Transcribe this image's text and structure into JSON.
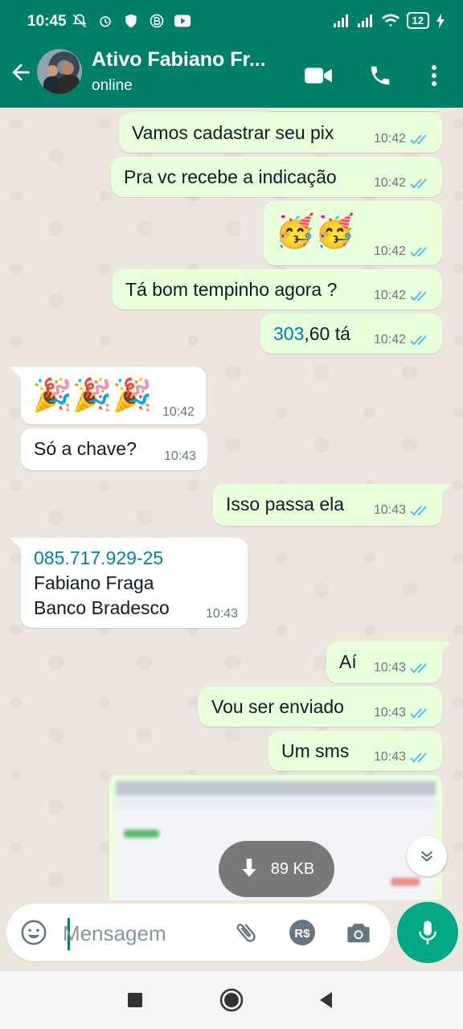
{
  "status_bar": {
    "time": "10:45",
    "battery": "12"
  },
  "header": {
    "contact_name": "Ativo Fabiano Fr...",
    "status": "online"
  },
  "messages": [
    {
      "text": "Vamos cadastrar seu pix",
      "time": "10:42"
    },
    {
      "text": "Pra vc recebe a indicação",
      "time": "10:42"
    },
    {
      "emoji": "🥳🥳",
      "time": "10:42"
    },
    {
      "text": "Tá bom tempinho agora ?",
      "time": "10:42"
    },
    {
      "link": "303",
      "text": ",60 tá",
      "time": "10:42"
    },
    {
      "emoji": "🎉🎉🎉",
      "time": "10:42"
    },
    {
      "text": "Só a chave?",
      "time": "10:43"
    },
    {
      "text": "Isso passa ela",
      "time": "10:43"
    },
    {
      "link": "085.717.929-25",
      "line2": "Fabiano Fraga",
      "line3": "Banco Bradesco",
      "time": "10:43"
    },
    {
      "text": "Aí",
      "time": "10:43"
    },
    {
      "text": "Vou ser enviado",
      "time": "10:43"
    },
    {
      "text": "Um sms",
      "time": "10:43"
    }
  ],
  "image_message": {
    "download_size": "89 KB"
  },
  "composer": {
    "placeholder": "Mensagem"
  },
  "colors": {
    "header": "#008069",
    "outgoing_bubble": "#e7ffdb",
    "incoming_bubble": "#ffffff",
    "ticks": "#53bdeb",
    "mic_button": "#00a884",
    "link": "#027eb5"
  },
  "icons": [
    "back-arrow-icon",
    "video-call-icon",
    "voice-call-icon",
    "more-options-icon",
    "read-ticks-icon",
    "emoji-icon",
    "attach-icon",
    "payment-icon",
    "camera-icon",
    "mic-icon",
    "download-icon",
    "scroll-down-icon",
    "nav-recents-icon",
    "nav-home-icon",
    "nav-back-icon"
  ]
}
